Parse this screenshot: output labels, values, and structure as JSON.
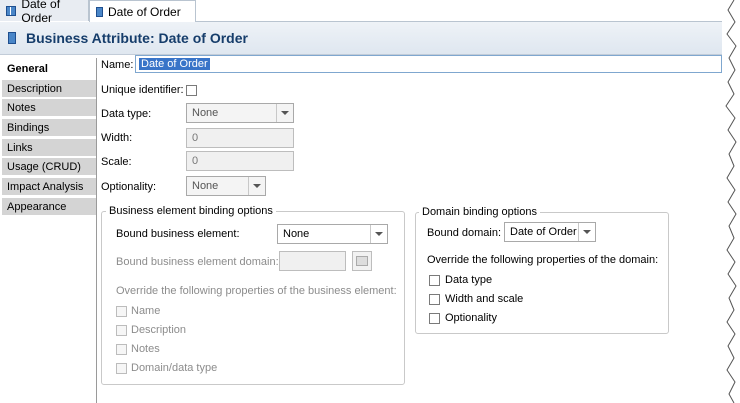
{
  "tabs": [
    {
      "label": "Date of Order",
      "active": false
    },
    {
      "label": "Date of Order",
      "active": true
    }
  ],
  "header": {
    "title": "Business Attribute: Date of Order"
  },
  "nav": [
    "General",
    "Description",
    "Notes",
    "Bindings",
    "Links",
    "Usage (CRUD)",
    "Impact Analysis",
    "Appearance"
  ],
  "form": {
    "name_label": "Name:",
    "name_value": "Date of Order",
    "unique_label": "Unique identifier:",
    "datatype_label": "Data type:",
    "datatype_value": "None",
    "width_label": "Width:",
    "width_value": "0",
    "scale_label": "Scale:",
    "scale_value": "0",
    "optionality_label": "Optionality:",
    "optionality_value": "None"
  },
  "business_group": {
    "title": "Business element binding options",
    "bound_label": "Bound business element:",
    "bound_value": "None",
    "domain_label": "Bound business element domain:",
    "override_label": "Override the following properties of the business element:",
    "options": [
      "Name",
      "Description",
      "Notes",
      "Domain/data type"
    ]
  },
  "domain_group": {
    "title": "Domain binding options",
    "bound_label": "Bound domain:",
    "bound_value": "Date of Order",
    "override_label": "Override the following properties of the domain:",
    "options": [
      "Data type",
      "Width and scale",
      "Optionality"
    ]
  }
}
